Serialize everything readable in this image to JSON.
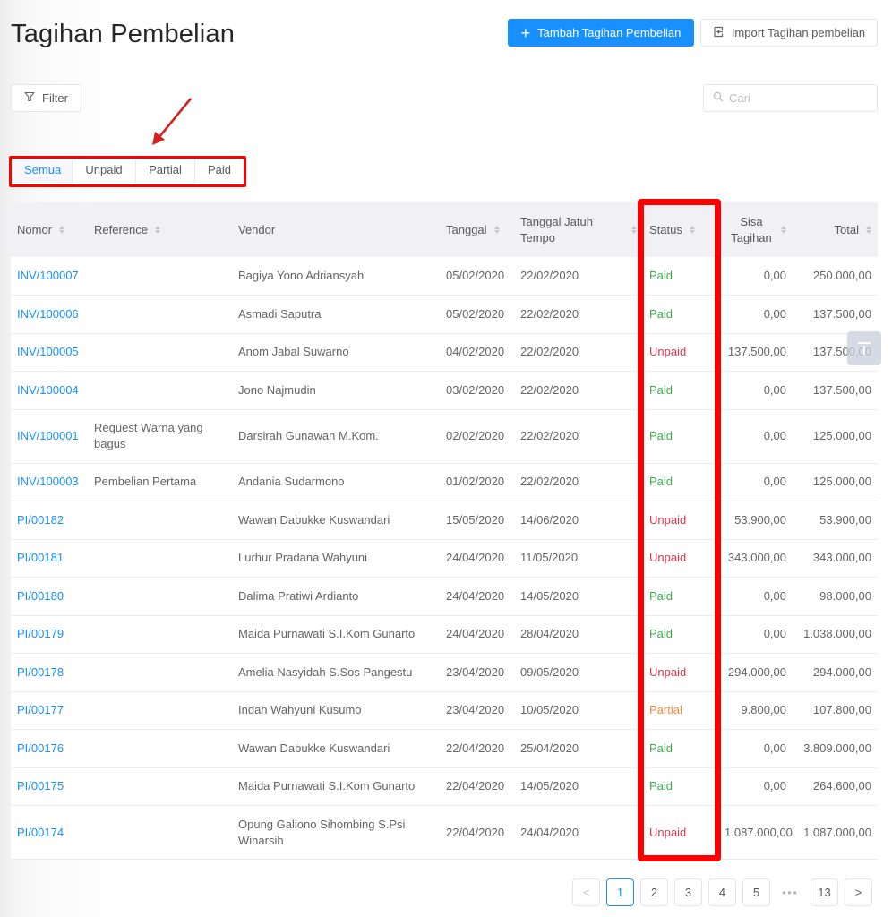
{
  "header": {
    "title": "Tagihan Pembelian",
    "add_button_label": "Tambah Tagihan Pembelian",
    "import_button_label": "Import Tagihan pembelian"
  },
  "toolbar": {
    "filter_label": "Filter",
    "search_placeholder": "Cari",
    "search_value": ""
  },
  "tabs": [
    {
      "label": "Semua",
      "active": true
    },
    {
      "label": "Unpaid",
      "active": false
    },
    {
      "label": "Partial",
      "active": false
    },
    {
      "label": "Paid",
      "active": false
    }
  ],
  "table": {
    "columns": [
      "Nomor",
      "Reference",
      "Vendor",
      "Tanggal",
      "Tanggal Jatuh Tempo",
      "Status",
      "Sisa Tagihan",
      "Total"
    ],
    "rows": [
      {
        "nomor": "INV/100007",
        "reference": "",
        "vendor": "Bagiya Yono Adriansyah",
        "tanggal": "05/02/2020",
        "jatuh_tempo": "22/02/2020",
        "status": "Paid",
        "sisa": "0,00",
        "total": "250.000,00"
      },
      {
        "nomor": "INV/100006",
        "reference": "",
        "vendor": "Asmadi Saputra",
        "tanggal": "05/02/2020",
        "jatuh_tempo": "22/02/2020",
        "status": "Paid",
        "sisa": "0,00",
        "total": "137.500,00"
      },
      {
        "nomor": "INV/100005",
        "reference": "",
        "vendor": "Anom Jabal Suwarno",
        "tanggal": "04/02/2020",
        "jatuh_tempo": "22/02/2020",
        "status": "Unpaid",
        "sisa": "137.500,00",
        "total": "137.500,00"
      },
      {
        "nomor": "INV/100004",
        "reference": "",
        "vendor": "Jono Najmudin",
        "tanggal": "03/02/2020",
        "jatuh_tempo": "22/02/2020",
        "status": "Paid",
        "sisa": "0,00",
        "total": "137.500,00"
      },
      {
        "nomor": "INV/100001",
        "reference": "Request Warna yang bagus",
        "vendor": "Darsirah Gunawan M.Kom.",
        "tanggal": "02/02/2020",
        "jatuh_tempo": "22/02/2020",
        "status": "Paid",
        "sisa": "0,00",
        "total": "125.000,00"
      },
      {
        "nomor": "INV/100003",
        "reference": "Pembelian Pertama",
        "vendor": "Andania Sudarmono",
        "tanggal": "01/02/2020",
        "jatuh_tempo": "22/02/2020",
        "status": "Paid",
        "sisa": "0,00",
        "total": "125.000,00"
      },
      {
        "nomor": "PI/00182",
        "reference": "",
        "vendor": "Wawan Dabukke Kuswandari",
        "tanggal": "15/05/2020",
        "jatuh_tempo": "14/06/2020",
        "status": "Unpaid",
        "sisa": "53.900,00",
        "total": "53.900,00"
      },
      {
        "nomor": "PI/00181",
        "reference": "",
        "vendor": "Lurhur Pradana Wahyuni",
        "tanggal": "24/04/2020",
        "jatuh_tempo": "11/05/2020",
        "status": "Unpaid",
        "sisa": "343.000,00",
        "total": "343.000,00"
      },
      {
        "nomor": "PI/00180",
        "reference": "",
        "vendor": "Dalima Pratiwi Ardianto",
        "tanggal": "24/04/2020",
        "jatuh_tempo": "14/05/2020",
        "status": "Paid",
        "sisa": "0,00",
        "total": "98.000,00"
      },
      {
        "nomor": "PI/00179",
        "reference": "",
        "vendor": "Maida Purnawati S.I.Kom Gunarto",
        "tanggal": "24/04/2020",
        "jatuh_tempo": "28/04/2020",
        "status": "Paid",
        "sisa": "0,00",
        "total": "1.038.000,00"
      },
      {
        "nomor": "PI/00178",
        "reference": "",
        "vendor": "Amelia Nasyidah S.Sos Pangestu",
        "tanggal": "23/04/2020",
        "jatuh_tempo": "09/05/2020",
        "status": "Unpaid",
        "sisa": "294.000,00",
        "total": "294.000,00"
      },
      {
        "nomor": "PI/00177",
        "reference": "",
        "vendor": "Indah Wahyuni Kusumo",
        "tanggal": "23/04/2020",
        "jatuh_tempo": "10/05/2020",
        "status": "Partial",
        "sisa": "9.800,00",
        "total": "107.800,00"
      },
      {
        "nomor": "PI/00176",
        "reference": "",
        "vendor": "Wawan Dabukke Kuswandari",
        "tanggal": "22/04/2020",
        "jatuh_tempo": "25/04/2020",
        "status": "Paid",
        "sisa": "0,00",
        "total": "3.809.000,00"
      },
      {
        "nomor": "PI/00175",
        "reference": "",
        "vendor": "Maida Purnawati S.I.Kom Gunarto",
        "tanggal": "22/04/2020",
        "jatuh_tempo": "14/05/2020",
        "status": "Paid",
        "sisa": "0,00",
        "total": "264.600,00"
      },
      {
        "nomor": "PI/00174",
        "reference": "",
        "vendor": "Opung Galiono Sihombing S.Psi Winarsih",
        "tanggal": "22/04/2020",
        "jatuh_tempo": "24/04/2020",
        "status": "Unpaid",
        "sisa": "1.087.000,00",
        "total": "1.087.000,00"
      }
    ]
  },
  "status_colors": {
    "Paid": "#3dae4d",
    "Unpaid": "#e3344f",
    "Partial": "#f7893b"
  },
  "accent_color": "#1890ff",
  "pagination": {
    "prev": "<",
    "next": ">",
    "pages": [
      "1",
      "2",
      "3",
      "4",
      "5"
    ],
    "ellipsis": "•••",
    "last": "13",
    "current": "1"
  }
}
